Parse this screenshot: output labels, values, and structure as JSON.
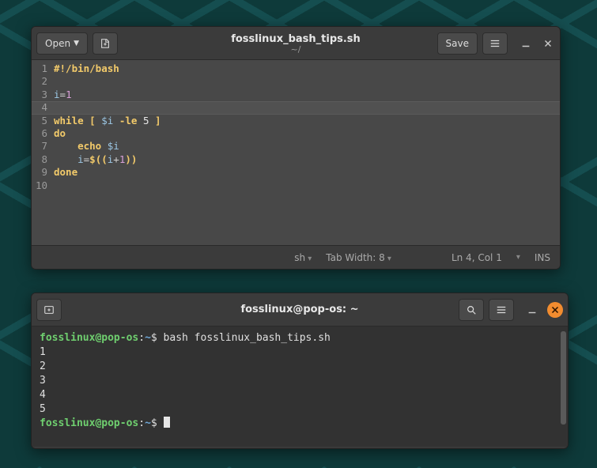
{
  "editor": {
    "header": {
      "open_label": "Open",
      "save_label": "Save",
      "title": "fosslinux_bash_tips.sh",
      "subtitle": "~/"
    },
    "gutter": [
      "1",
      "2",
      "3",
      "4",
      "5",
      "6",
      "7",
      "8",
      "9",
      "10"
    ],
    "code": {
      "l1_shebang": "#!/bin/bash",
      "l3_var": "i",
      "l3_eq": "=",
      "l3_val": "1",
      "l5_while": "while",
      "l5_lb": "[",
      "l5_var": "$i",
      "l5_op": "-le",
      "l5_num": "5",
      "l5_rb": "]",
      "l6_do": "do",
      "l7_echo": "echo",
      "l7_var": "$i",
      "l8_var": "i",
      "l8_eq": "=",
      "l8_dollar": "$",
      "l8_open": "((",
      "l8_i": "i",
      "l8_plus": "+",
      "l8_one": "1",
      "l8_close": "))",
      "l9_done": "done"
    },
    "current_line_index": 3,
    "status": {
      "lang": "sh",
      "tab": "Tab Width: 8",
      "pos": "Ln 4, Col 1",
      "ins": "INS"
    }
  },
  "terminal": {
    "title": "fosslinux@pop-os: ~",
    "prompt": {
      "user": "fosslinux@pop-os",
      "sep": ":",
      "path": "~",
      "sym": "$"
    },
    "command": "bash fosslinux_bash_tips.sh",
    "output": [
      "1",
      "2",
      "3",
      "4",
      "5"
    ]
  }
}
